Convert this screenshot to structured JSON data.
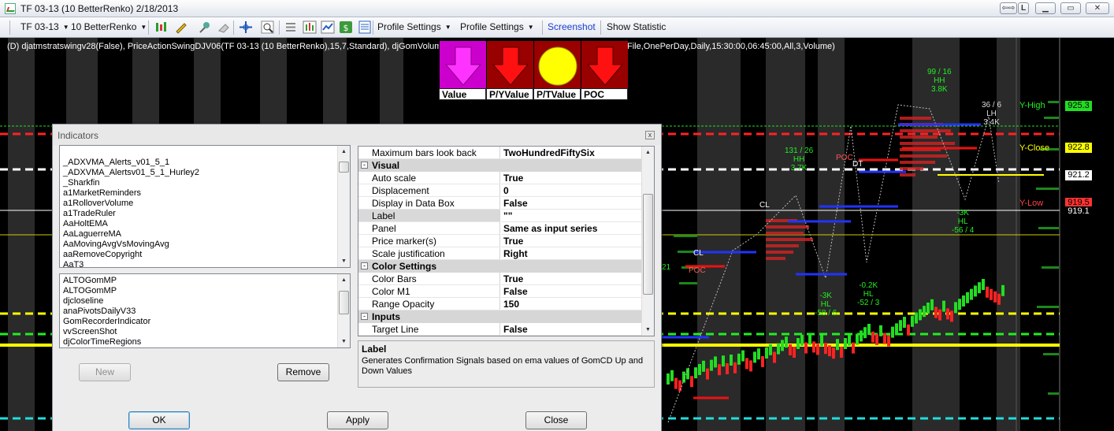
{
  "window": {
    "title": "TF 03-13 (10 BetterRenko)  2/18/2013",
    "buttons": {
      "link": "L"
    }
  },
  "toolbar": {
    "instrument": "TF 03-13",
    "period": "10 BetterRenko",
    "profile_settings_1": "Profile Settings",
    "profile_settings_2": "Profile Settings",
    "screenshot": "Screenshot",
    "show_statistic": "Show Statistic"
  },
  "chart": {
    "indicator_line": "(D) djatmstratswingv28(False), PriceActionSwingDJV06(TF 03-13 (10 BetterRenko),15,7,Standard), djGomVolumeAreas2v1(TF 03-13 (10 BetterRenko),NinjaTickFile,OnePerDay,Daily,15:30:00,06:45:00,All,3,Volume)",
    "volume_panel": [
      {
        "label": "Value",
        "color": "#ff00ff",
        "shape": "arrow-down"
      },
      {
        "label": "P/YValue",
        "color": "#ff0000",
        "shape": "arrow-down"
      },
      {
        "label": "P/TValue",
        "color": "#ffff00",
        "shape": "circle"
      },
      {
        "label": "POC",
        "color": "#ff0000",
        "shape": "arrow-down"
      }
    ],
    "levels": {
      "y_high": "Y-High",
      "y_close": "Y-Close",
      "y_low": "Y-Low"
    },
    "price_tags": [
      {
        "value": "925.3",
        "bg": "#22dd22",
        "fg": "#000000"
      },
      {
        "value": "922.8",
        "bg": "#ffff00",
        "fg": "#000000"
      },
      {
        "value": "921.2",
        "bg": "#ffffff",
        "fg": "#000000"
      },
      {
        "value": "919.5",
        "bg": "#ff3333",
        "fg": "#000000"
      },
      {
        "value": "919.1",
        "bg": "#000000",
        "fg": "#ffffff"
      }
    ],
    "swing_labels": [
      {
        "lines": [
          "99 / 16",
          "HH",
          "3.8K"
        ]
      },
      {
        "lines": [
          "131 / 26",
          "HH",
          "3.7K"
        ]
      },
      {
        "lines": [
          "36 / 6",
          "LH",
          "3.4K"
        ]
      },
      {
        "lines": [
          "-3K",
          "HL",
          "-56 / 4"
        ]
      },
      {
        "lines": [
          "-0.2K",
          "HL",
          "-52 / 3"
        ]
      },
      {
        "lines": [
          "-3K",
          "HL",
          "-58 / 6"
        ]
      }
    ],
    "small_marks": {
      "dt": "DT",
      "cl": "CL",
      "poc": "POC",
      "n21": "21",
      "hl": "HL"
    }
  },
  "dialog": {
    "title": "Indicators",
    "close": "x",
    "available_list": [
      "_ADXVMA_Alerts_v01_5_1",
      "_ADXVMA_Alertsv01_5_1_Hurley2",
      "_Sharkfin",
      "a1MarketReminders",
      "a1RolloverVolume",
      "a1TradeRuler",
      "AaHoltEMA",
      "AaLaguerreMA",
      "AaMovingAvgVsMovingAvg",
      "aaRemoveCopyright",
      "AaT3"
    ],
    "applied_list": [
      "ALTOGomMP",
      "ALTOGomMP",
      "djcloseline",
      "anaPivotsDailyV33",
      "GomRecorderIndicator",
      "vvScreenShot",
      "djColorTimeRegions"
    ],
    "buttons": {
      "new": "New",
      "remove": "Remove",
      "ok": "OK",
      "apply": "Apply",
      "close": "Close"
    },
    "properties": {
      "top_row": {
        "name": "Maximum bars look back",
        "value": "TwoHundredFiftySix"
      },
      "visual_category": "Visual",
      "visual": [
        {
          "name": "Auto scale",
          "value": "True"
        },
        {
          "name": "Displacement",
          "value": "0"
        },
        {
          "name": "Display in Data Box",
          "value": "False"
        },
        {
          "name": "Label",
          "value": "\"\""
        },
        {
          "name": "Panel",
          "value": "Same as input series"
        },
        {
          "name": "Price marker(s)",
          "value": "True"
        },
        {
          "name": "Scale justification",
          "value": "Right"
        }
      ],
      "color_category": "Color Settings",
      "color": [
        {
          "name": "Color Bars",
          "value": "True"
        },
        {
          "name": "Color M1",
          "value": "False"
        },
        {
          "name": "Range Opacity",
          "value": "150"
        }
      ],
      "inputs_category": "Inputs",
      "inputs": [
        {
          "name": "Target Line",
          "value": "False"
        }
      ],
      "expander": "-"
    },
    "help": {
      "title": "Label",
      "description": "Generates Confirmation Signals based on ema values of GomCD Up and Down Values"
    }
  }
}
